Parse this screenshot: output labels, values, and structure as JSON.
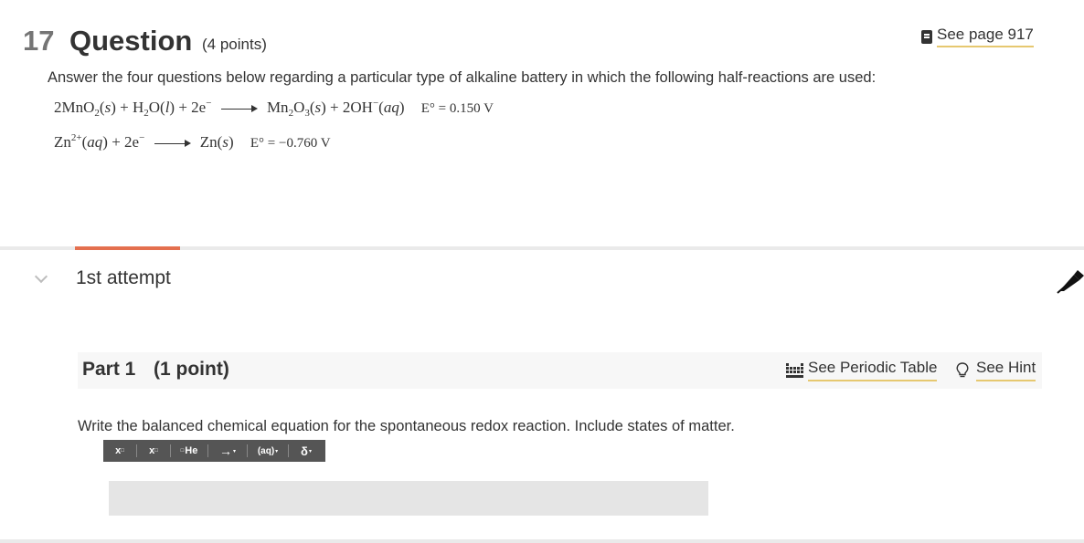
{
  "question": {
    "number": "17",
    "title": "Question",
    "points": "(4 points)",
    "see_page": "See page 917",
    "intro": "Answer the four questions below regarding a particular type of alkaline battery in which the following half-reactions are used:"
  },
  "equations": {
    "eq1": {
      "reactants": [
        "2MnO",
        "2",
        "(",
        "s",
        ") + H",
        "2",
        "O(",
        "l",
        ") + 2e",
        "−"
      ],
      "products": [
        "Mn",
        "2",
        "O",
        "3",
        "(",
        "s",
        ") + 2OH",
        "−",
        "(",
        "aq",
        ")"
      ],
      "potential": "E° = 0.150 V"
    },
    "eq2": {
      "reactants": [
        "Zn",
        "2+",
        "(",
        "aq",
        ") + 2e",
        "−"
      ],
      "products": [
        "Zn(",
        "s",
        ")"
      ],
      "potential": "E° = −0.760 V"
    }
  },
  "attempt": {
    "label": "1st attempt"
  },
  "part": {
    "title": "Part 1",
    "points": "(1 point)",
    "see_periodic_table": "See Periodic Table",
    "see_hint": "See Hint",
    "prompt": "Write the balanced chemical equation for the spontaneous redox reaction. Include states of matter."
  },
  "toolbar": {
    "superscript": "x",
    "subscript": "x",
    "element": "He",
    "arrow": "→",
    "state": "(aq)",
    "delta": "δ"
  },
  "answer": {
    "value": ""
  },
  "colors": {
    "accent": "#e4704f",
    "link_underline": "#e6c870",
    "toolbar_bg": "#555555",
    "answer_bg": "#e5e5e5"
  }
}
